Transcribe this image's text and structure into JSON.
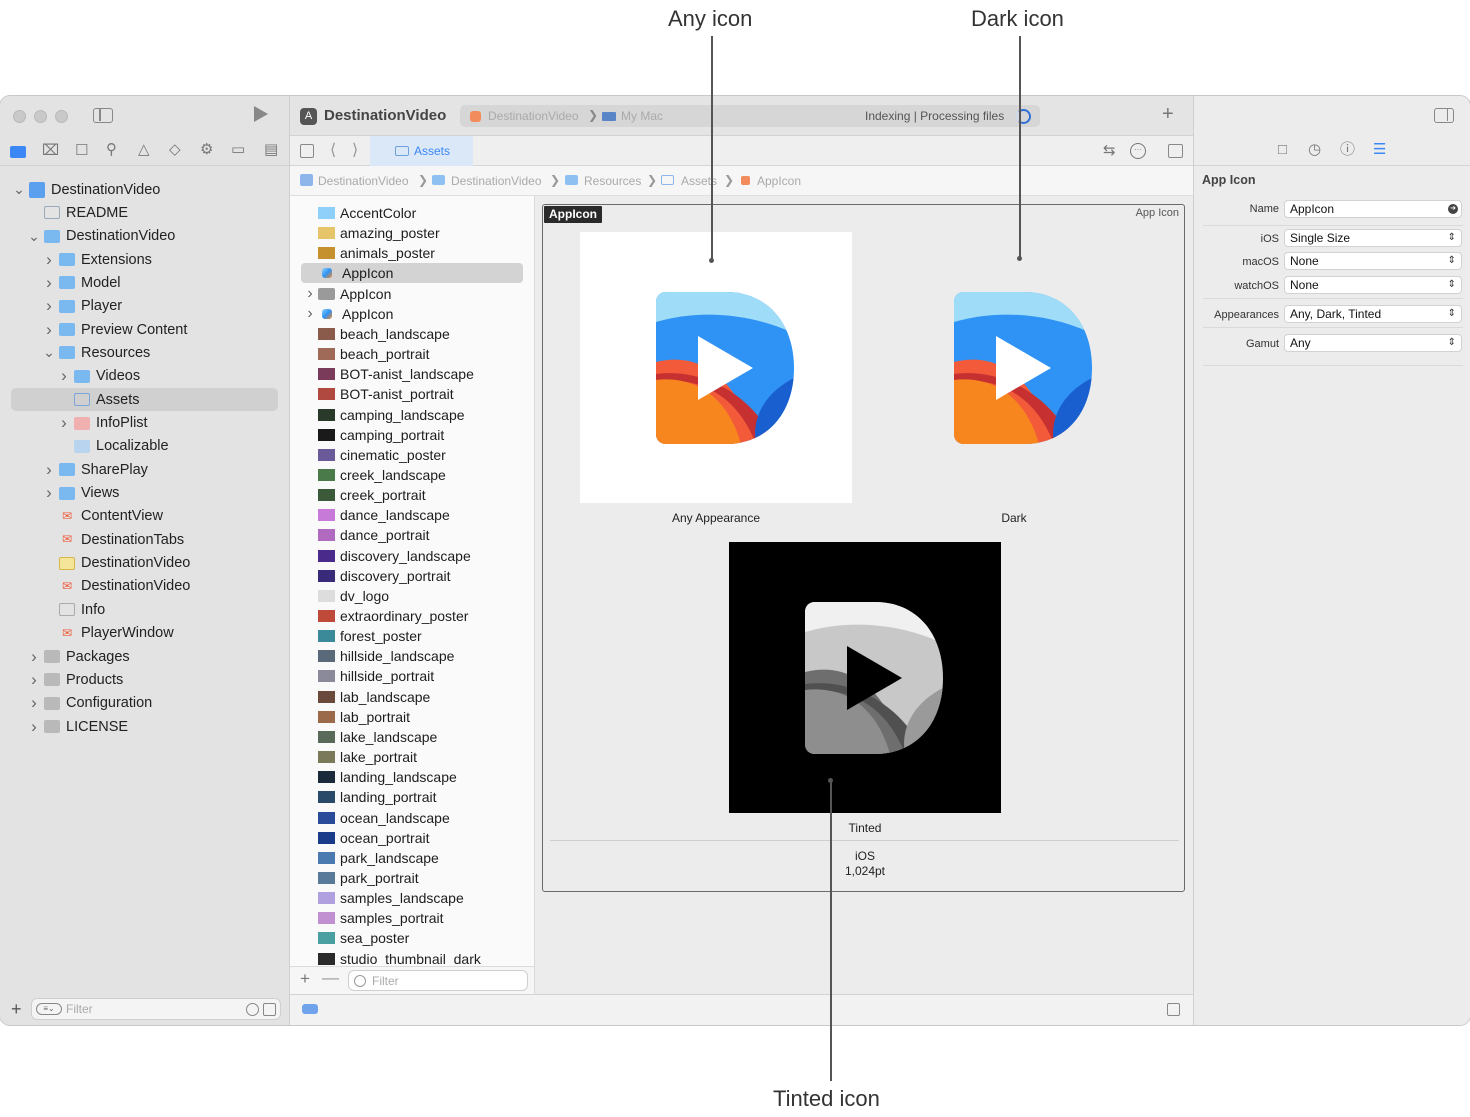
{
  "callouts": {
    "any_icon": "Any icon",
    "dark_icon": "Dark icon",
    "tinted_icon": "Tinted icon"
  },
  "project_nav": {
    "items": [
      {
        "label": "DestinationVideo",
        "kind": "project",
        "chevron": "down"
      },
      {
        "label": "README",
        "kind": "book"
      },
      {
        "label": "DestinationVideo",
        "kind": "folder",
        "chevron": "down"
      },
      {
        "label": "Extensions",
        "kind": "folder",
        "chevron": "right"
      },
      {
        "label": "Model",
        "kind": "folder",
        "chevron": "right"
      },
      {
        "label": "Player",
        "kind": "folder",
        "chevron": "right"
      },
      {
        "label": "Preview Content",
        "kind": "folder",
        "chevron": "right"
      },
      {
        "label": "Resources",
        "kind": "folder",
        "chevron": "down"
      },
      {
        "label": "Videos",
        "kind": "folder",
        "chevron": "right"
      },
      {
        "label": "Assets",
        "kind": "assets",
        "selected": true
      },
      {
        "label": "InfoPlist",
        "kind": "plist",
        "chevron": "right"
      },
      {
        "label": "Localizable",
        "kind": "strings"
      },
      {
        "label": "SharePlay",
        "kind": "folder",
        "chevron": "right"
      },
      {
        "label": "Views",
        "kind": "folder",
        "chevron": "right"
      },
      {
        "label": "ContentView",
        "kind": "swift"
      },
      {
        "label": "DestinationTabs",
        "kind": "swift"
      },
      {
        "label": "DestinationVideo",
        "kind": "entitlements"
      },
      {
        "label": "DestinationVideo",
        "kind": "swift"
      },
      {
        "label": "Info",
        "kind": "table"
      },
      {
        "label": "PlayerWindow",
        "kind": "swift"
      },
      {
        "label": "Packages",
        "kind": "folder-grey",
        "chevron": "right"
      },
      {
        "label": "Products",
        "kind": "folder-grey",
        "chevron": "right"
      },
      {
        "label": "Configuration",
        "kind": "folder-grey",
        "chevron": "right"
      },
      {
        "label": "LICENSE",
        "kind": "folder-grey",
        "chevron": "right"
      }
    ],
    "filter_placeholder": "Filter"
  },
  "toolbar": {
    "project_title": "DestinationVideo",
    "scheme": "DestinationVideo",
    "destination": "My Mac",
    "status": "Indexing | Processing files"
  },
  "tab": {
    "label": "Assets"
  },
  "jump_bar": [
    "DestinationVideo",
    "DestinationVideo",
    "Resources",
    "Assets",
    "AppIcon"
  ],
  "assets": {
    "items": [
      {
        "label": "AccentColor",
        "thumb": "#8fd0fb"
      },
      {
        "label": "amazing_poster",
        "thumb": "#e5c46a"
      },
      {
        "label": "animals_poster",
        "thumb": "#c4912e"
      },
      {
        "label": "AppIcon",
        "thumb": "appicon",
        "selected": true
      },
      {
        "label": "AppIcon",
        "thumb": "folder",
        "chevron": true
      },
      {
        "label": "AppIcon",
        "thumb": "appicon",
        "chevron": true
      },
      {
        "label": "beach_landscape",
        "thumb": "#8a5a4a"
      },
      {
        "label": "beach_portrait",
        "thumb": "#a06a58"
      },
      {
        "label": "BOT-anist_landscape",
        "thumb": "#7a3a5a"
      },
      {
        "label": "BOT-anist_portrait",
        "thumb": "#b04a40"
      },
      {
        "label": "camping_landscape",
        "thumb": "#2a3a2a"
      },
      {
        "label": "camping_portrait",
        "thumb": "#1a1a1a"
      },
      {
        "label": "cinematic_poster",
        "thumb": "#6a5a9a"
      },
      {
        "label": "creek_landscape",
        "thumb": "#4a7a4a"
      },
      {
        "label": "creek_portrait",
        "thumb": "#3a5a3a"
      },
      {
        "label": "dance_landscape",
        "thumb": "#c87ad8"
      },
      {
        "label": "dance_portrait",
        "thumb": "#b06ac0"
      },
      {
        "label": "discovery_landscape",
        "thumb": "#4a2a8a"
      },
      {
        "label": "discovery_portrait",
        "thumb": "#3a2a7a"
      },
      {
        "label": "dv_logo",
        "thumb": "#dddddd"
      },
      {
        "label": "extraordinary_poster",
        "thumb": "#c04a3a"
      },
      {
        "label": "forest_poster",
        "thumb": "#3a8a9a"
      },
      {
        "label": "hillside_landscape",
        "thumb": "#5a6a7a"
      },
      {
        "label": "hillside_portrait",
        "thumb": "#8a8a9a"
      },
      {
        "label": "lab_landscape",
        "thumb": "#6a4a3a"
      },
      {
        "label": "lab_portrait",
        "thumb": "#9a6a4a"
      },
      {
        "label": "lake_landscape",
        "thumb": "#5a6a5a"
      },
      {
        "label": "lake_portrait",
        "thumb": "#7a7a5a"
      },
      {
        "label": "landing_landscape",
        "thumb": "#1a2a3a"
      },
      {
        "label": "landing_portrait",
        "thumb": "#2a4a6a"
      },
      {
        "label": "ocean_landscape",
        "thumb": "#2a4a9a"
      },
      {
        "label": "ocean_portrait",
        "thumb": "#1a3a8a"
      },
      {
        "label": "park_landscape",
        "thumb": "#4a7ab0"
      },
      {
        "label": "park_portrait",
        "thumb": "#5a7a9a"
      },
      {
        "label": "samples_landscape",
        "thumb": "#b0a0e0"
      },
      {
        "label": "samples_portrait",
        "thumb": "#c090d0"
      },
      {
        "label": "sea_poster",
        "thumb": "#4aa0a0"
      },
      {
        "label": "studio_thumbnail_dark",
        "thumb": "#2a2a2a"
      }
    ],
    "filter_placeholder": "Filter"
  },
  "iconset": {
    "badge": "AppIcon",
    "type_label": "App Icon",
    "wells": [
      {
        "label": "Any Appearance"
      },
      {
        "label": "Dark"
      },
      {
        "label": "Tinted"
      }
    ],
    "platform": "iOS",
    "size": "1,024pt"
  },
  "inspector": {
    "section_title": "App Icon",
    "name_label": "Name",
    "name_value": "AppIcon",
    "ios_label": "iOS",
    "ios_value": "Single Size",
    "macos_label": "macOS",
    "macos_value": "None",
    "watchos_label": "watchOS",
    "watchos_value": "None",
    "appearances_label": "Appearances",
    "appearances_value": "Any, Dark, Tinted",
    "gamut_label": "Gamut",
    "gamut_value": "Any"
  },
  "colors": {
    "accent": "#3b87f5",
    "selection": "#d0d0d0",
    "folder": "#7ab8f0"
  }
}
